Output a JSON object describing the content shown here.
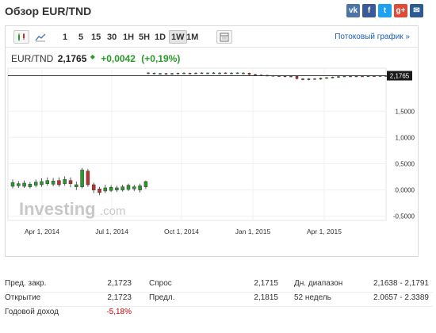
{
  "header": {
    "title": "Обзор EUR/TND"
  },
  "social": [
    {
      "icon": "vk-icon",
      "label": "vk",
      "color": "#4c75a3"
    },
    {
      "icon": "facebook-icon",
      "label": "f",
      "color": "#3b5998"
    },
    {
      "icon": "twitter-icon",
      "label": "t",
      "color": "#1da1f2"
    },
    {
      "icon": "googleplus-icon",
      "label": "g+",
      "color": "#dd4b39"
    },
    {
      "icon": "mail-icon",
      "label": "✉",
      "color": "#2b5b92"
    }
  ],
  "toolbar": {
    "periods": [
      "1",
      "5",
      "15",
      "30",
      "1H",
      "5H",
      "1D",
      "1W",
      "1M"
    ],
    "selected": "1W",
    "stream_label": "Потоковый график »"
  },
  "quote": {
    "symbol": "EUR/TND",
    "last": "2,1765",
    "change": "+0,0042",
    "change_pct": "(+0,19%)",
    "up_color": "#2a9a2a",
    "down_color": "#c03030"
  },
  "watermark": {
    "brand": "Investing",
    "suffix": ".com"
  },
  "chart_data": {
    "type": "candlestick",
    "last_price_label": "2,1765",
    "y_ticks": [
      "1,5000",
      "1,0000",
      "0,5000",
      "0,0000",
      "-0,5000"
    ],
    "y_tick_values": [
      1.5,
      1.0,
      0.5,
      0.0,
      -0.5
    ],
    "x_ticks": [
      "Apr 1, 2014",
      "Jul 1, 2014",
      "Oct 1, 2014",
      "Jan 1, 2015",
      "Apr 1, 2015"
    ],
    "ylim": [
      -0.58,
      2.32
    ],
    "series": [
      {
        "o": 0.07,
        "c": 0.14,
        "h": 0.2,
        "l": 0.03
      },
      {
        "o": 0.08,
        "c": 0.12,
        "h": 0.17,
        "l": 0.04
      },
      {
        "o": 0.07,
        "c": 0.13,
        "h": 0.18,
        "l": 0.04
      },
      {
        "o": 0.06,
        "c": 0.11,
        "h": 0.15,
        "l": 0.03
      },
      {
        "o": 0.09,
        "c": 0.15,
        "h": 0.2,
        "l": 0.05
      },
      {
        "o": 0.1,
        "c": 0.16,
        "h": 0.22,
        "l": 0.06
      },
      {
        "o": 0.12,
        "c": 0.18,
        "h": 0.24,
        "l": 0.08
      },
      {
        "o": 0.11,
        "c": 0.17,
        "h": 0.23,
        "l": 0.07
      },
      {
        "o": 0.18,
        "c": 0.1,
        "h": 0.24,
        "l": 0.06
      },
      {
        "o": 0.12,
        "c": 0.2,
        "h": 0.26,
        "l": 0.08
      },
      {
        "o": 0.18,
        "c": 0.12,
        "h": 0.24,
        "l": 0.05
      },
      {
        "o": 0.06,
        "c": 0.1,
        "h": 0.16,
        "l": 0.0
      },
      {
        "o": 0.06,
        "c": 0.38,
        "h": 0.42,
        "l": 0.03
      },
      {
        "o": 0.36,
        "c": 0.1,
        "h": 0.4,
        "l": 0.06
      },
      {
        "o": 0.1,
        "c": 0.0,
        "h": 0.14,
        "l": -0.06
      },
      {
        "o": 0.02,
        "c": -0.05,
        "h": 0.06,
        "l": -0.1
      },
      {
        "o": -0.02,
        "c": 0.04,
        "h": 0.1,
        "l": -0.06
      },
      {
        "o": -0.01,
        "c": 0.05,
        "h": 0.09,
        "l": -0.04
      },
      {
        "o": 0.0,
        "c": 0.04,
        "h": 0.08,
        "l": -0.04
      },
      {
        "o": 0.0,
        "c": 0.06,
        "h": 0.1,
        "l": -0.03
      },
      {
        "o": 0.01,
        "c": 0.09,
        "h": 0.12,
        "l": -0.02
      },
      {
        "o": 0.02,
        "c": 0.06,
        "h": 0.1,
        "l": -0.02
      },
      {
        "o": 0.0,
        "c": 0.08,
        "h": 0.12,
        "l": -0.05
      },
      {
        "o": 0.06,
        "c": 0.16,
        "h": 0.18,
        "l": 0.02
      },
      {
        "o": 2.22,
        "c": 2.23,
        "h": 2.24,
        "l": 2.21
      },
      {
        "o": 2.22,
        "c": 2.225,
        "h": 2.235,
        "l": 2.21
      },
      {
        "o": 2.215,
        "c": 2.22,
        "h": 2.23,
        "l": 2.205
      },
      {
        "o": 2.22,
        "c": 2.215,
        "h": 2.23,
        "l": 2.205
      },
      {
        "o": 2.215,
        "c": 2.22,
        "h": 2.23,
        "l": 2.205
      },
      {
        "o": 2.22,
        "c": 2.225,
        "h": 2.235,
        "l": 2.21
      },
      {
        "o": 2.22,
        "c": 2.228,
        "h": 2.24,
        "l": 2.21
      },
      {
        "o": 2.225,
        "c": 2.22,
        "h": 2.235,
        "l": 2.21
      },
      {
        "o": 2.22,
        "c": 2.228,
        "h": 2.24,
        "l": 2.21
      },
      {
        "o": 2.225,
        "c": 2.23,
        "h": 2.24,
        "l": 2.215
      },
      {
        "o": 2.225,
        "c": 2.228,
        "h": 2.24,
        "l": 2.215
      },
      {
        "o": 2.225,
        "c": 2.23,
        "h": 2.245,
        "l": 2.215
      },
      {
        "o": 2.225,
        "c": 2.228,
        "h": 2.24,
        "l": 2.215
      },
      {
        "o": 2.23,
        "c": 2.225,
        "h": 2.24,
        "l": 2.215
      },
      {
        "o": 2.22,
        "c": 2.228,
        "h": 2.24,
        "l": 2.21
      },
      {
        "o": 2.225,
        "c": 2.23,
        "h": 2.24,
        "l": 2.215
      },
      {
        "o": 2.225,
        "c": 2.228,
        "h": 2.24,
        "l": 2.215
      },
      {
        "o": 2.225,
        "c": 2.2,
        "h": 2.235,
        "l": 2.19
      },
      {
        "o": 2.2,
        "c": 2.195,
        "h": 2.21,
        "l": 2.185
      },
      {
        "o": 2.19,
        "c": 2.185,
        "h": 2.2,
        "l": 2.18
      },
      {
        "o": 2.185,
        "c": 2.18,
        "h": 2.195,
        "l": 2.17
      },
      {
        "o": 2.18,
        "c": 2.175,
        "h": 2.19,
        "l": 2.165
      },
      {
        "o": 2.175,
        "c": 2.17,
        "h": 2.185,
        "l": 2.16
      },
      {
        "o": 2.17,
        "c": 2.168,
        "h": 2.18,
        "l": 2.155
      },
      {
        "o": 2.168,
        "c": 2.165,
        "h": 2.178,
        "l": 2.15
      },
      {
        "o": 2.165,
        "c": 2.12,
        "h": 2.17,
        "l": 2.11
      },
      {
        "o": 2.12,
        "c": 2.1,
        "h": 2.13,
        "l": 2.09
      },
      {
        "o": 2.1,
        "c": 2.12,
        "h": 2.13,
        "l": 2.09
      },
      {
        "o": 2.12,
        "c": 2.11,
        "h": 2.13,
        "l": 2.1
      },
      {
        "o": 2.11,
        "c": 2.13,
        "h": 2.14,
        "l": 2.1
      },
      {
        "o": 2.13,
        "c": 2.14,
        "h": 2.15,
        "l": 2.12
      },
      {
        "o": 2.14,
        "c": 2.15,
        "h": 2.16,
        "l": 2.13
      },
      {
        "o": 2.15,
        "c": 2.16,
        "h": 2.17,
        "l": 2.14
      },
      {
        "o": 2.16,
        "c": 2.17,
        "h": 2.18,
        "l": 2.15
      },
      {
        "o": 2.17,
        "c": 2.165,
        "h": 2.18,
        "l": 2.155
      },
      {
        "o": 2.165,
        "c": 2.17,
        "h": 2.18,
        "l": 2.155
      },
      {
        "o": 2.17,
        "c": 2.168,
        "h": 2.18,
        "l": 2.16
      },
      {
        "o": 2.168,
        "c": 2.172,
        "h": 2.18,
        "l": 2.16
      },
      {
        "o": 2.172,
        "c": 2.17,
        "h": 2.18,
        "l": 2.16
      },
      {
        "o": 2.17,
        "c": 2.176,
        "h": 2.18,
        "l": 2.165
      },
      {
        "o": 2.172,
        "c": 2.1765,
        "h": 2.18,
        "l": 2.165
      }
    ]
  },
  "stats": [
    {
      "l1": "Пред. закр.",
      "v1": "2,1723",
      "l2": "Спрос",
      "v2": "2,1715",
      "l3": "Дн. диапазон",
      "v3": "2,1638 - 2,1791"
    },
    {
      "l1": "Открытие",
      "v1": "2,1723",
      "l2": "Предл.",
      "v2": "2,1815",
      "l3": "52 недель",
      "v3": "2.0657 - 2.3389"
    },
    {
      "l1": "Годовой доход",
      "v1": "-5,18%",
      "l2": "",
      "v2": "",
      "l3": "",
      "v3": ""
    }
  ]
}
